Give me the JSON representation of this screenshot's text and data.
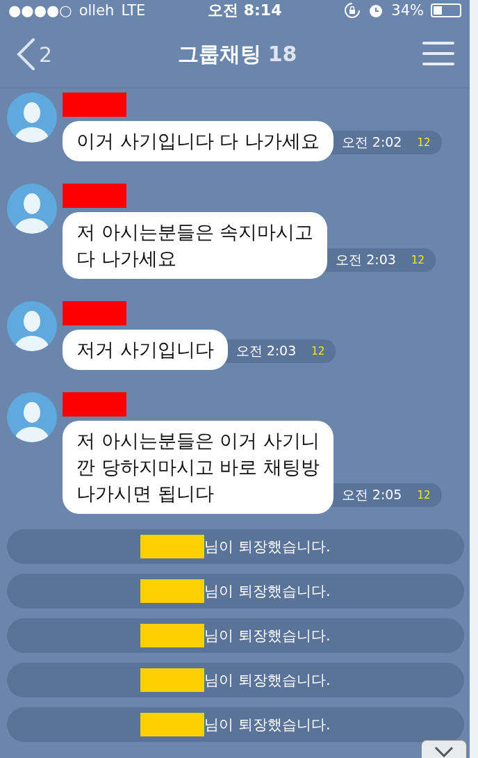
{
  "status_bar": {
    "signal_dots": "●●●●○",
    "carrier": "olleh",
    "network": "LTE",
    "time": "오전 8:14",
    "battery": "34%"
  },
  "header": {
    "back_count": "2",
    "title": "그룹채팅",
    "member_count": "18"
  },
  "messages": [
    {
      "text": "이거 사기입니다 다 나가세요",
      "time": "오전 2:02",
      "unread": "12"
    },
    {
      "text": "저 아시는분들은 속지마시고\n다 나가세요",
      "time": "오전 2:03",
      "unread": "12"
    },
    {
      "text": "저거 사기입니다",
      "time": "오전 2:03",
      "unread": "12"
    },
    {
      "text": "저 아시는분들은 이거 사기니\n깐 당하지마시고 바로 채팅방\n나가시면 됩니다",
      "time": "오전 2:05",
      "unread": "12"
    }
  ],
  "notices": [
    {
      "text": "님이 퇴장했습니다."
    },
    {
      "text": "님이 퇴장했습니다."
    },
    {
      "text": "님이 퇴장했습니다."
    },
    {
      "text": "님이 퇴장했습니다."
    },
    {
      "text": "님이 퇴장했습니다."
    }
  ]
}
